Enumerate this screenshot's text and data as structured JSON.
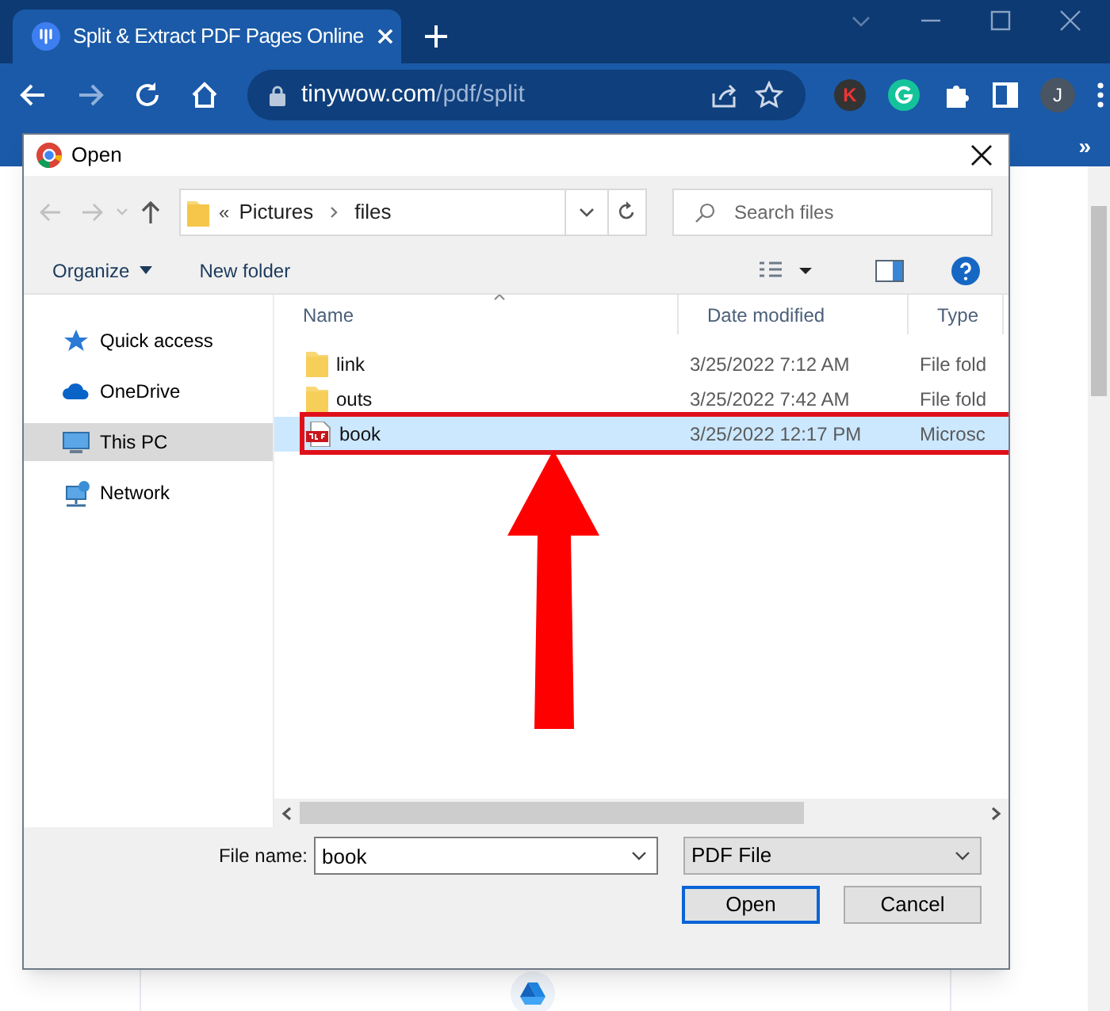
{
  "browser": {
    "tab": {
      "title": "Split & Extract PDF Pages Online",
      "selected": true
    },
    "address": {
      "host": "tinywow.com",
      "path": "/pdf/split"
    },
    "extension_letter": "K",
    "profile_letter": "J",
    "bookmarks_overflow": "»"
  },
  "dialog": {
    "title": "Open",
    "breadcrumb_overflow": "«",
    "breadcrumb": [
      "Pictures",
      "files"
    ],
    "search": {
      "placeholder": "Search files"
    },
    "commands": [
      {
        "label": "Organize",
        "dropdown": true
      },
      {
        "label": "New folder",
        "dropdown": false
      }
    ],
    "nav": [
      {
        "label": "Quick access",
        "selected": false
      },
      {
        "label": "OneDrive",
        "selected": false
      },
      {
        "label": "This PC",
        "selected": true
      },
      {
        "label": "Network",
        "selected": false
      }
    ],
    "columns": [
      "Name",
      "Date modified",
      "Type"
    ],
    "rows": [
      {
        "kind": "folder",
        "name": "link",
        "date": "3/25/2022 7:12 AM",
        "type": "File fold",
        "selected": false,
        "highlighted": false
      },
      {
        "kind": "folder",
        "name": "outs",
        "date": "3/25/2022 7:42 AM",
        "type": "File fold",
        "selected": false,
        "highlighted": false
      },
      {
        "kind": "pdf",
        "name": "book",
        "date": "3/25/2022 12:17 PM",
        "type": "Microsc",
        "selected": true,
        "highlighted": true
      }
    ],
    "file_name": {
      "label": "File name:",
      "value": "book"
    },
    "file_type": "PDF File",
    "buttons": [
      {
        "label": "Open",
        "default": true
      },
      {
        "label": "Cancel",
        "default": false
      }
    ]
  }
}
